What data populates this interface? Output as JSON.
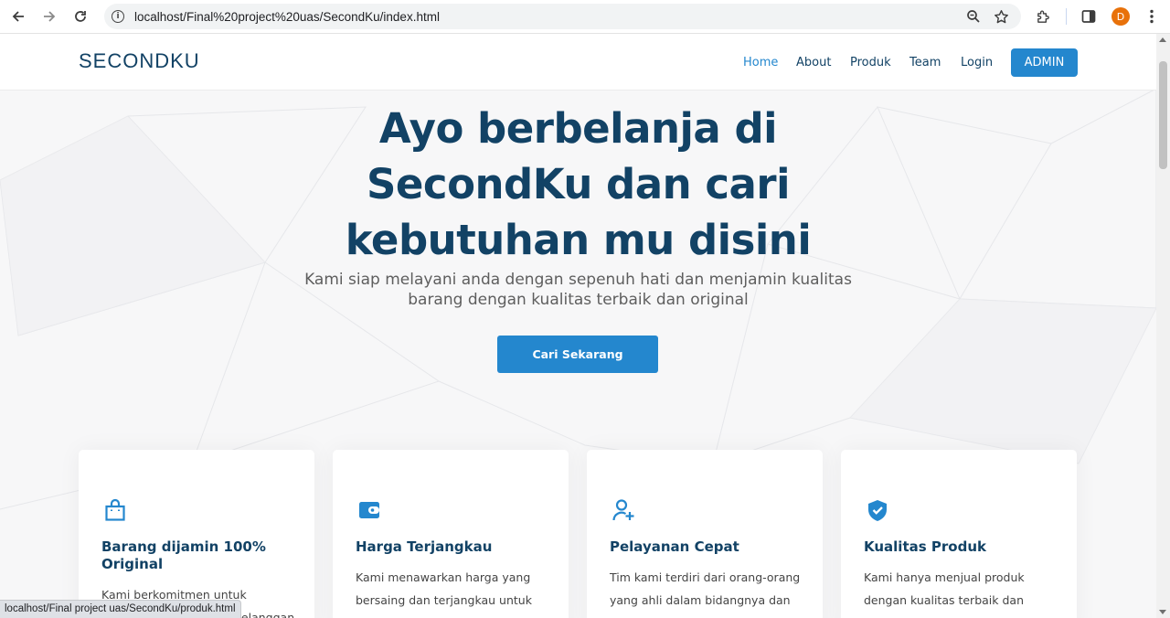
{
  "browser": {
    "url": "localhost/Final%20project%20uas/SecondKu/index.html",
    "profile_initial": "D",
    "status_url": "localhost/Final project uas/SecondKu/produk.html"
  },
  "navbar": {
    "logo": "SECONDKU",
    "items": [
      "Home",
      "About",
      "Produk",
      "Team",
      "Login"
    ],
    "admin_label": "ADMIN"
  },
  "hero": {
    "title_lines": [
      "Ayo berbelanja di",
      "SecondKu dan cari",
      "kebutuhan mu disini"
    ],
    "subtitle_lines": [
      "Kami siap melayani anda dengan sepenuh hati dan menjamin kualitas",
      "barang dengan kualitas terbaik dan original"
    ],
    "cta_label": "Cari Sekarang"
  },
  "features": [
    {
      "icon": "shopping-bag-icon",
      "title": "Barang dijamin 100% Original",
      "text_lines": [
        "Kami berkomitmen untuk",
        "pelanggan"
      ]
    },
    {
      "icon": "wallet-icon",
      "title": "Harga Terjangkau",
      "text_lines": [
        "Kami menawarkan harga yang",
        "bersaing dan terjangkau untuk"
      ]
    },
    {
      "icon": "person-add-icon",
      "title": "Pelayanan Cepat",
      "text_lines": [
        "Tim kami terdiri dari orang-orang",
        "yang ahli dalam bidangnya dan"
      ]
    },
    {
      "icon": "shield-check-icon",
      "title": "Kualitas Produk",
      "text_lines": [
        "Kami hanya menjual produk",
        "dengan kualitas terbaik dan"
      ]
    }
  ],
  "colors": {
    "accent": "#2487ce",
    "heading": "#124265"
  }
}
